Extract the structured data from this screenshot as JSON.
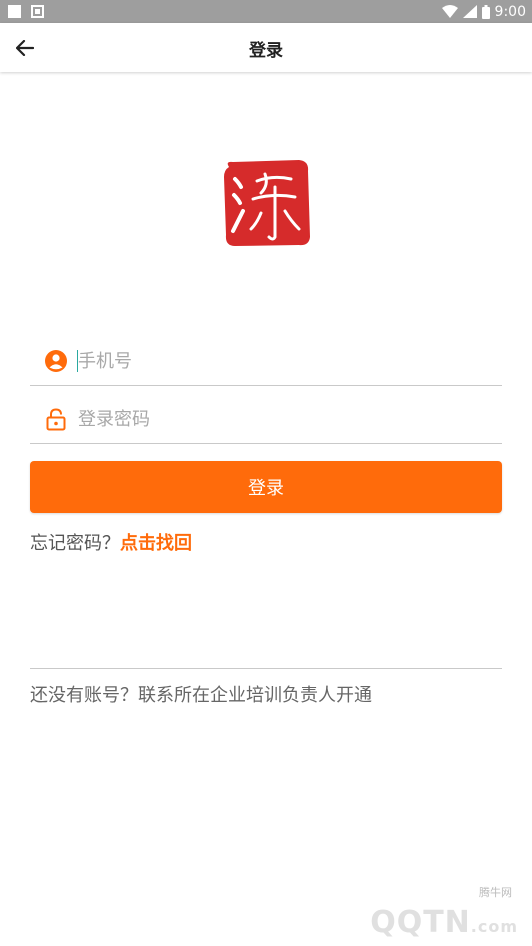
{
  "status_bar": {
    "time": "9:00",
    "icons": [
      "notification-square-icon",
      "app-notification-icon",
      "wifi-icon",
      "signal-icon",
      "battery-icon"
    ]
  },
  "app_bar": {
    "title": "登录",
    "back_icon": "arrow-left-icon"
  },
  "logo": {
    "char": "涤",
    "color": "#d62b2b"
  },
  "form": {
    "phone": {
      "placeholder": "手机号",
      "value": "",
      "icon": "user-circle-icon"
    },
    "password": {
      "placeholder": "登录密码",
      "value": "",
      "icon": "lock-icon"
    },
    "login_button": "登录"
  },
  "forgot": {
    "prefix": "忘记密码？",
    "link": "点击找回"
  },
  "footer": {
    "note": "还没有账号？联系所在企业培训负责人开通"
  },
  "watermark": {
    "small": "腾牛网",
    "brand": "QQTN",
    "suffix": ".com"
  },
  "colors": {
    "accent": "#ff6b0b",
    "status_bar": "#9e9e9e",
    "logo_red": "#d62b2b"
  }
}
